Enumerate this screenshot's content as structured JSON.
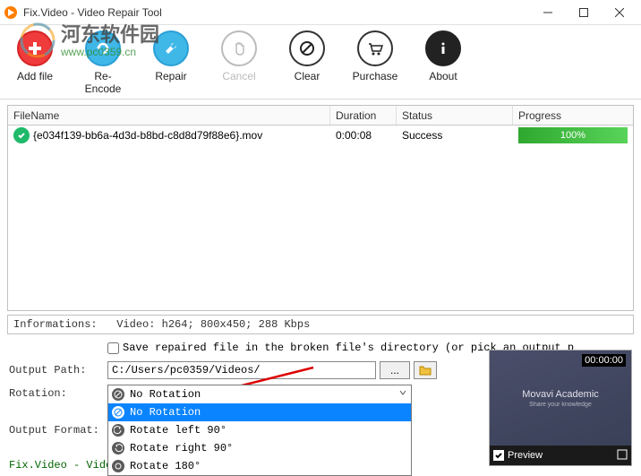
{
  "window": {
    "title": "Fix.Video - Video Repair Tool"
  },
  "watermark": {
    "text": "河东软件园",
    "url": "www.pc0359.cn"
  },
  "toolbar": {
    "add": "Add file",
    "reencode": "Re-Encode",
    "repair": "Repair",
    "cancel": "Cancel",
    "clear": "Clear",
    "purchase": "Purchase",
    "about": "About"
  },
  "grid": {
    "headers": {
      "filename": "FileName",
      "duration": "Duration",
      "status": "Status",
      "progress": "Progress"
    },
    "rows": [
      {
        "name": "{e034f139-bb6a-4d3d-b8bd-c8d8d79f88e6}.mov",
        "duration": "0:00:08",
        "status": "Success",
        "progress": "100%"
      }
    ]
  },
  "info": {
    "label": "Informations:",
    "text": "Video: h264; 800x450; 288 Kbps"
  },
  "settings": {
    "save_check": "Save repaired file in the broken file's directory (or pick an output p",
    "output_label": "Output Path:",
    "output_value": "C:/Users/pc0359/Videos/",
    "browse_dots": "...",
    "rotation_label": "Rotation:",
    "format_label": "Output Format:",
    "rotation_selected": "No Rotation",
    "rotation_options": [
      "No Rotation",
      "Rotate left 90°",
      "Rotate right 90°",
      "Rotate 180°"
    ]
  },
  "preview": {
    "time": "00:00:00",
    "brand": "Movavi Academic",
    "tagline": "Share your knowledge",
    "label": "Preview"
  },
  "footer_link": "Fix.Video - Vide"
}
